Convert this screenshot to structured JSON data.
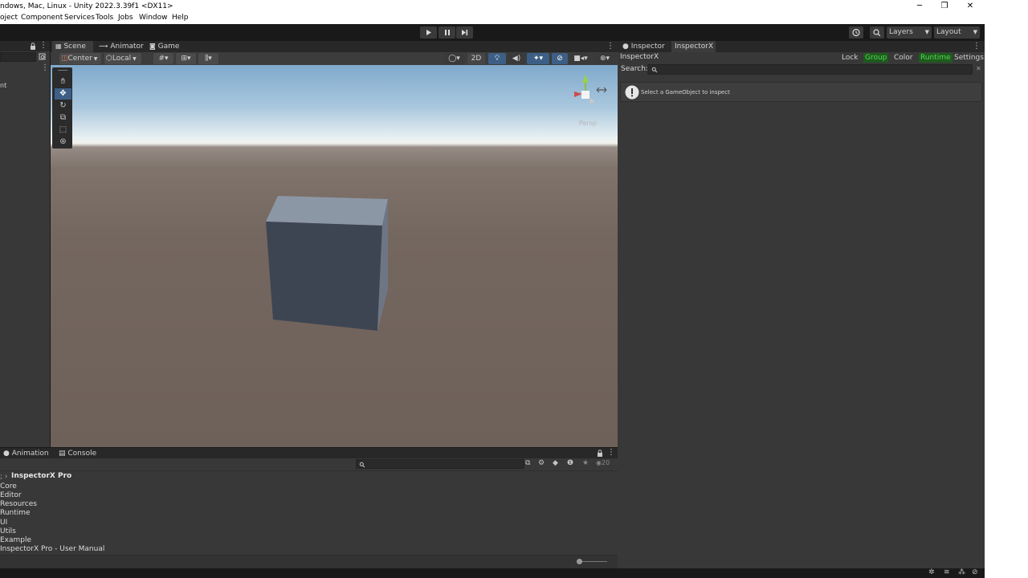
{
  "window": {
    "title": "ndows, Mac, Linux - Unity 2022.3.39f1 <DX11>",
    "minimize_glyph": "─",
    "restore_glyph": "❐",
    "close_glyph": "✕"
  },
  "menu": [
    "oject",
    "Component",
    "Services",
    "Tools",
    "Jobs",
    "Window",
    "Help"
  ],
  "toolbar": {
    "layers_label": "Layers",
    "layout_label": "Layout"
  },
  "hierarchy": {
    "partial_item": "nt"
  },
  "scene": {
    "tabs": [
      "Scene",
      "Animator",
      "Game"
    ],
    "pivot_label": "Center",
    "space_label": "Local",
    "mode_2d_label": "2D",
    "gizmo_label": "Persp"
  },
  "inspector": {
    "tabs": [
      "Inspector",
      "InspectorX"
    ],
    "title": "InspectorX",
    "buttons": [
      "Lock",
      "Group",
      "Color",
      "Runtime",
      "Settings"
    ],
    "search_label": "Search:",
    "message": "Select a GameObject to inspect"
  },
  "project": {
    "tabs": [
      "Animation",
      "Console"
    ],
    "breadcrumb": "InspectorX Pro",
    "hidden_count": "20",
    "folders": [
      "Core",
      "Editor",
      "Resources",
      "Runtime",
      "UI",
      "Utils",
      "Example",
      "InspectorX Pro - User Manual"
    ]
  },
  "colors": {
    "accent": "#4d7cb8",
    "active_green": "#55d655",
    "background": "#383838"
  }
}
